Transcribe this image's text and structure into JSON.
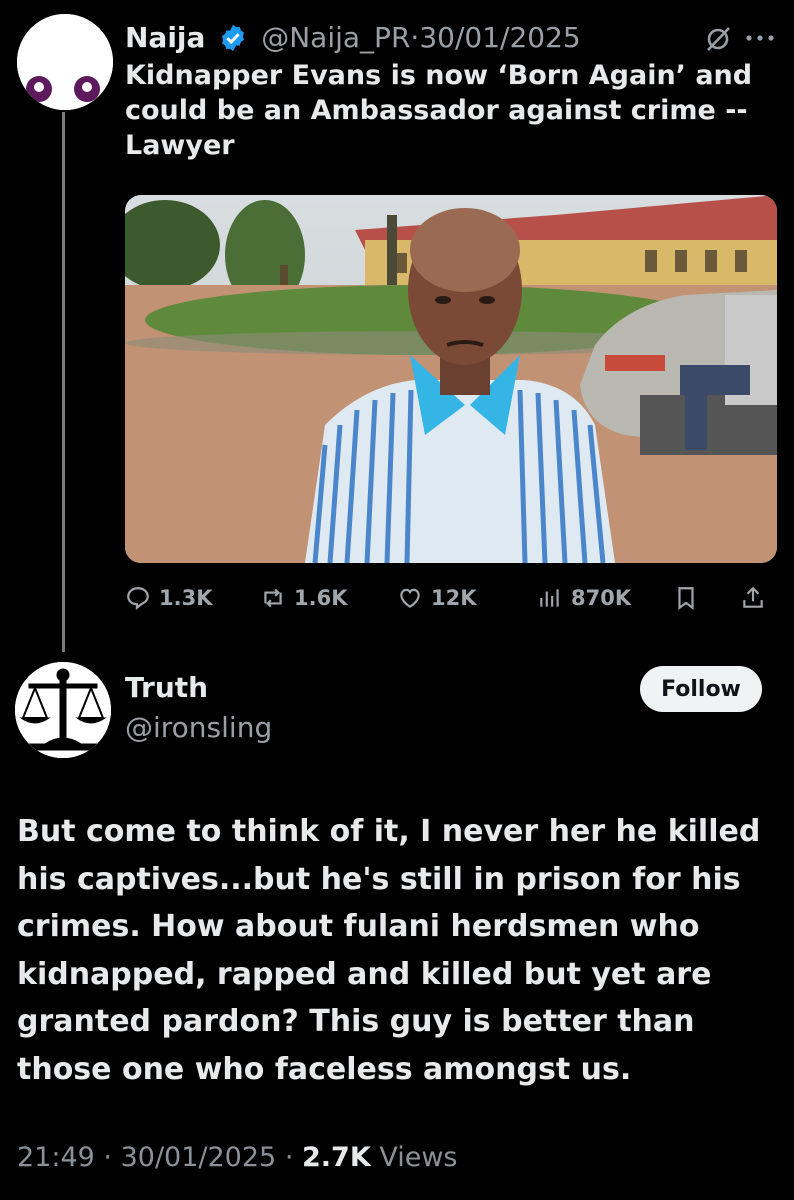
{
  "quoted": {
    "author_name": "Naija",
    "handle": "@Naija_PR",
    "separator": "·",
    "date": "30/01/2025",
    "text": "Kidnapper Evans is now ‘Born Again’ and could be an Ambassador against crime -- Lawyer",
    "stats": {
      "replies": "1.3K",
      "reposts": "1.6K",
      "likes": "12K",
      "views": "870K"
    },
    "icons": [
      "verified-badge-icon",
      "grok-icon",
      "more-icon",
      "reply-icon",
      "repost-icon",
      "like-icon",
      "views-icon",
      "bookmark-icon",
      "share-icon"
    ],
    "accent_color": "#1d9bf0"
  },
  "reply": {
    "author_name": "Truth",
    "handle": "@ironsling",
    "follow_label": "Follow",
    "text": "But come to think of it, I never her he killed his captives...but he's still in prison for his crimes. How about fulani herdsmen who kidnapped, rapped and killed but yet are granted pardon? This guy is better than those one who faceless amongst us.",
    "time": "21:49",
    "separator": "·",
    "date": "30/01/2025",
    "views_count": "2.7K",
    "views_label": "Views"
  }
}
